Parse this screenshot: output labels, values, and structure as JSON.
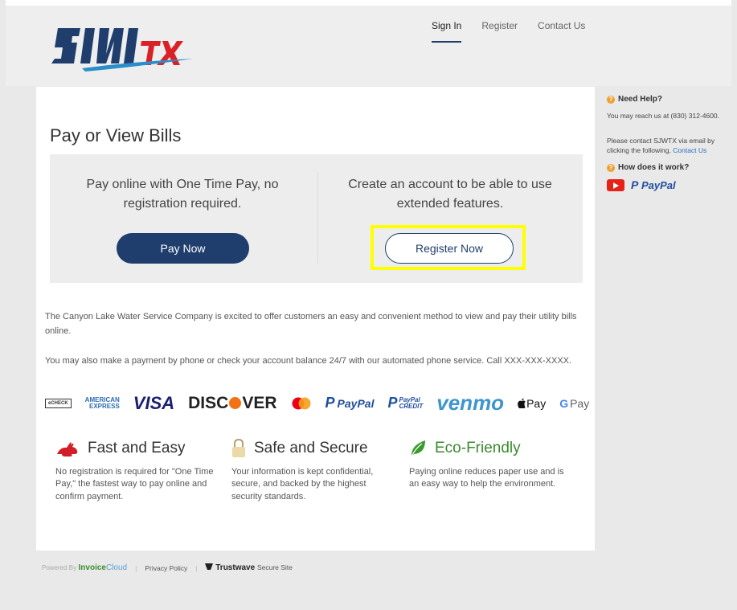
{
  "header": {
    "nav": [
      "Sign In",
      "Register",
      "Contact Us"
    ],
    "logo_text": "SJWTX"
  },
  "main": {
    "title": "Pay or View Bills",
    "cta_left_text": "Pay online with One Time Pay, no registration required.",
    "cta_right_text": "Create an account to be able to use extended features.",
    "pay_button": "Pay Now",
    "register_button": "Register Now",
    "para1": "The Canyon Lake Water Service Company is excited to offer customers an easy and convenient method to view and pay their utility bills online.",
    "para2": "You may also make a payment by phone or check your account balance 24/7 with our automated phone service. Call XXX-XXX-XXXX."
  },
  "payments": {
    "echeck": "eCHECK",
    "amex_line1": "AMERICAN",
    "amex_line2": "EXPRESS",
    "visa": "VISA",
    "discover_a": "DISC",
    "discover_b": "VER",
    "paypal": "PayPal",
    "paypal_credit_line1": "PayPal",
    "paypal_credit_line2": "CREDIT",
    "venmo": "venmo",
    "applepay": "Pay",
    "gpay": "Pay"
  },
  "features": [
    {
      "title": "Fast and Easy",
      "text": "No registration is required for \"One Time Pay,\" the fastest way to pay online and confirm payment."
    },
    {
      "title": "Safe and Secure",
      "text": "Your information is kept confidential, secure, and backed by the highest security standards."
    },
    {
      "title": "Eco-Friendly",
      "text": "Paying online reduces paper use and is an easy way to help the environment."
    }
  ],
  "sidebar": {
    "help_title": "Need Help?",
    "phone_text": "You may reach us at (830) 312-4600.",
    "email_text": "Please contact SJWTX via email by clicking the following,",
    "contact_link": "Contact Us",
    "how_title": "How does it work?",
    "paypal": "PayPal"
  },
  "footer": {
    "powered": "Powered By",
    "invoice": "Invoice",
    "cloud": "Cloud",
    "privacy": "Privacy Policy",
    "trustwave": "Trustwave",
    "secure": "Secure Site"
  },
  "colors": {
    "brand_navy": "#1f3e6d",
    "highlight": "#ffff00",
    "eco_green": "#3a8a2e"
  }
}
